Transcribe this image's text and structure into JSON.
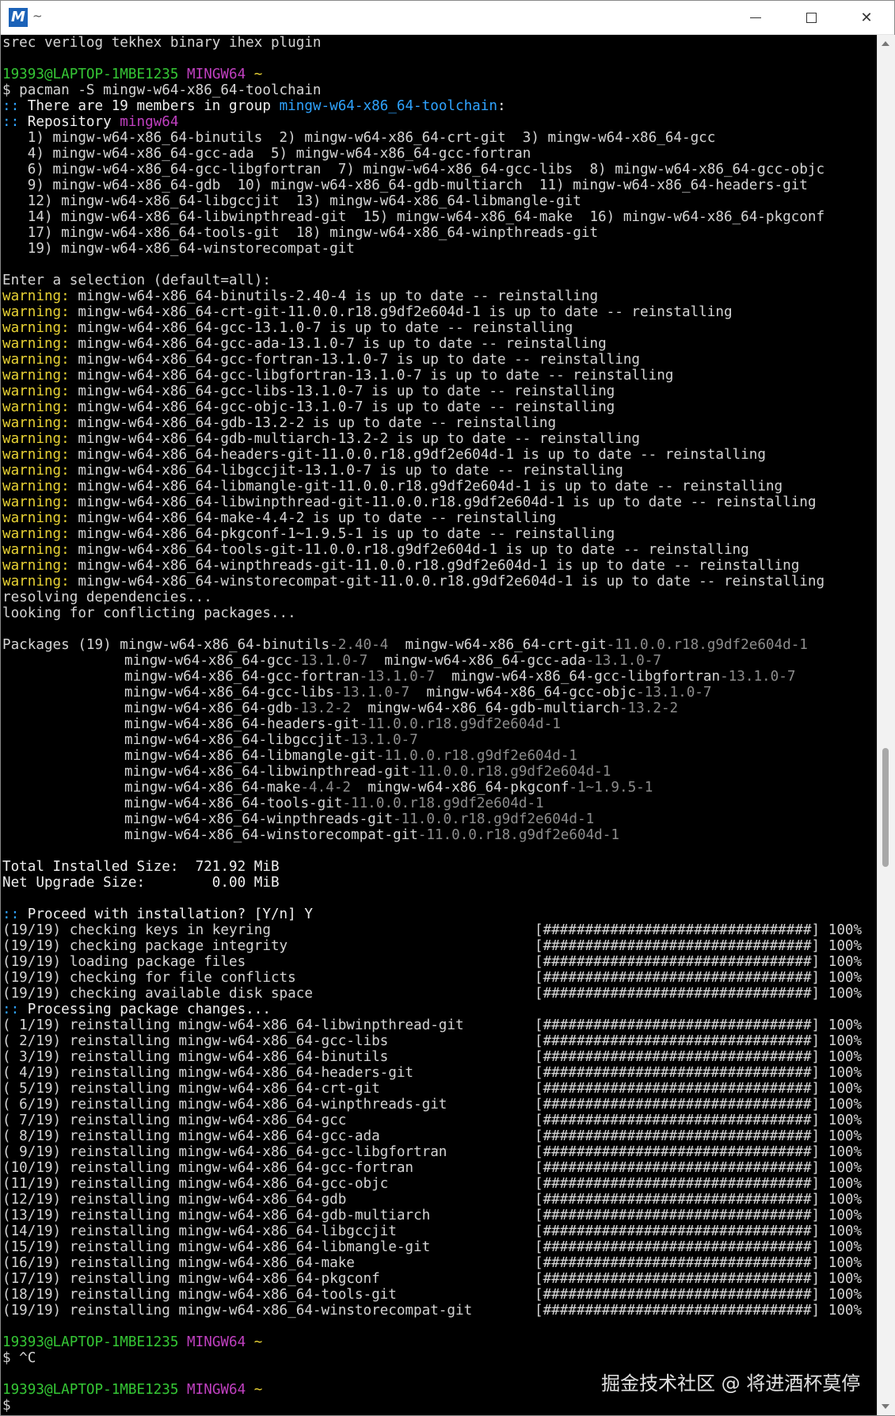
{
  "window": {
    "title": "~",
    "app_icon": "M",
    "controls": {
      "minimize": "minimize-icon",
      "maximize": "maximize-icon",
      "close": "close-icon"
    }
  },
  "prompt": {
    "user_host": "19393@LAPTOP-1MBE1235",
    "env": "MINGW64",
    "dir": "~"
  },
  "lines": {
    "l0": "srec verilog tekhex binary ihex plugin",
    "cmd1": "$ pacman -S mingw-w64-x86_64-toolchain",
    "members_pre": " There are 19 members in group ",
    "group_name": "mingw-w64-x86_64-toolchain",
    "colon": ":",
    "sep": "::",
    "repo_pre": " Repository ",
    "repo_name": "mingw64",
    "g1": "   1) mingw-w64-x86_64-binutils  2) mingw-w64-x86_64-crt-git  3) mingw-w64-x86_64-gcc",
    "g2": "   4) mingw-w64-x86_64-gcc-ada  5) mingw-w64-x86_64-gcc-fortran",
    "g3": "   6) mingw-w64-x86_64-gcc-libgfortran  7) mingw-w64-x86_64-gcc-libs  8) mingw-w64-x86_64-gcc-objc",
    "g4": "   9) mingw-w64-x86_64-gdb  10) mingw-w64-x86_64-gdb-multiarch  11) mingw-w64-x86_64-headers-git",
    "g5": "   12) mingw-w64-x86_64-libgccjit  13) mingw-w64-x86_64-libmangle-git",
    "g6": "   14) mingw-w64-x86_64-libwinpthread-git  15) mingw-w64-x86_64-make  16) mingw-w64-x86_64-pkgconf",
    "g7": "   17) mingw-w64-x86_64-tools-git  18) mingw-w64-x86_64-winpthreads-git",
    "g8": "   19) mingw-w64-x86_64-winstorecompat-git",
    "enter_sel": "Enter a selection (default=all):",
    "warn_label": "warning:",
    "w1": " mingw-w64-x86_64-binutils-2.40-4 is up to date -- reinstalling",
    "w2": " mingw-w64-x86_64-crt-git-11.0.0.r18.g9df2e604d-1 is up to date -- reinstalling",
    "w3": " mingw-w64-x86_64-gcc-13.1.0-7 is up to date -- reinstalling",
    "w4": " mingw-w64-x86_64-gcc-ada-13.1.0-7 is up to date -- reinstalling",
    "w5": " mingw-w64-x86_64-gcc-fortran-13.1.0-7 is up to date -- reinstalling",
    "w6": " mingw-w64-x86_64-gcc-libgfortran-13.1.0-7 is up to date -- reinstalling",
    "w7": " mingw-w64-x86_64-gcc-libs-13.1.0-7 is up to date -- reinstalling",
    "w8": " mingw-w64-x86_64-gcc-objc-13.1.0-7 is up to date -- reinstalling",
    "w9": " mingw-w64-x86_64-gdb-13.2-2 is up to date -- reinstalling",
    "w10": " mingw-w64-x86_64-gdb-multiarch-13.2-2 is up to date -- reinstalling",
    "w11": " mingw-w64-x86_64-headers-git-11.0.0.r18.g9df2e604d-1 is up to date -- reinstalling",
    "w12": " mingw-w64-x86_64-libgccjit-13.1.0-7 is up to date -- reinstalling",
    "w13": " mingw-w64-x86_64-libmangle-git-11.0.0.r18.g9df2e604d-1 is up to date -- reinstalling",
    "w14": " mingw-w64-x86_64-libwinpthread-git-11.0.0.r18.g9df2e604d-1 is up to date -- reinstalling",
    "w15": " mingw-w64-x86_64-make-4.4-2 is up to date -- reinstalling",
    "w16": " mingw-w64-x86_64-pkgconf-1~1.9.5-1 is up to date -- reinstalling",
    "w17": " mingw-w64-x86_64-tools-git-11.0.0.r18.g9df2e604d-1 is up to date -- reinstalling",
    "w18": " mingw-w64-x86_64-winpthreads-git-11.0.0.r18.g9df2e604d-1 is up to date -- reinstalling",
    "w19": " mingw-w64-x86_64-winstorecompat-git-11.0.0.r18.g9df2e604d-1 is up to date -- reinstalling",
    "resolving": "resolving dependencies...",
    "conflicting": "looking for conflicting packages...",
    "pkg_header": "Packages (19) ",
    "pk1a": "mingw-w64-x86_64-binutils",
    "pk1av": "-2.40-4",
    "pk1b": "  mingw-w64-x86_64-crt-git",
    "pk1bv": "-11.0.0.r18.g9df2e604d-1",
    "pk2a": "mingw-w64-x86_64-gcc",
    "pk2av": "-13.1.0-7",
    "pk2b": "  mingw-w64-x86_64-gcc-ada",
    "pk2bv": "-13.1.0-7",
    "pk3a": "mingw-w64-x86_64-gcc-fortran",
    "pk3av": "-13.1.0-7",
    "pk3b": "  mingw-w64-x86_64-gcc-libgfortran",
    "pk3bv": "-13.1.0-7",
    "pk4a": "mingw-w64-x86_64-gcc-libs",
    "pk4av": "-13.1.0-7",
    "pk4b": "  mingw-w64-x86_64-gcc-objc",
    "pk4bv": "-13.1.0-7",
    "pk5a": "mingw-w64-x86_64-gdb",
    "pk5av": "-13.2-2",
    "pk5b": "  mingw-w64-x86_64-gdb-multiarch",
    "pk5bv": "-13.2-2",
    "pk6a": "mingw-w64-x86_64-headers-git",
    "pk6av": "-11.0.0.r18.g9df2e604d-1",
    "pk7a": "mingw-w64-x86_64-libgccjit",
    "pk7av": "-13.1.0-7",
    "pk8a": "mingw-w64-x86_64-libmangle-git",
    "pk8av": "-11.0.0.r18.g9df2e604d-1",
    "pk9a": "mingw-w64-x86_64-libwinpthread-git",
    "pk9av": "-11.0.0.r18.g9df2e604d-1",
    "pk10a": "mingw-w64-x86_64-make",
    "pk10av": "-4.4-2",
    "pk10b": "  mingw-w64-x86_64-pkgconf",
    "pk10bv": "-1~1.9.5-1",
    "pk11a": "mingw-w64-x86_64-tools-git",
    "pk11av": "-11.0.0.r18.g9df2e604d-1",
    "pk12a": "mingw-w64-x86_64-winpthreads-git",
    "pk12av": "-11.0.0.r18.g9df2e604d-1",
    "pk13a": "mingw-w64-x86_64-winstorecompat-git",
    "pk13av": "-11.0.0.r18.g9df2e604d-1",
    "total_installed": "Total Installed Size:  721.92 MiB",
    "net_upgrade": "Net Upgrade Size:        0.00 MiB",
    "proceed": " Proceed with installation? [Y/n] Y",
    "processing": " Processing package changes...",
    "ctrl_c": "$ ^C",
    "dollar": "$"
  },
  "progress_bar": "[################################] 100%",
  "steps": [
    "(19/19) checking keys in keyring",
    "(19/19) checking package integrity",
    "(19/19) loading package files",
    "(19/19) checking for file conflicts",
    "(19/19) checking available disk space"
  ],
  "reinstalls": [
    "( 1/19) reinstalling mingw-w64-x86_64-libwinpthread-git",
    "( 2/19) reinstalling mingw-w64-x86_64-gcc-libs",
    "( 3/19) reinstalling mingw-w64-x86_64-binutils",
    "( 4/19) reinstalling mingw-w64-x86_64-headers-git",
    "( 5/19) reinstalling mingw-w64-x86_64-crt-git",
    "( 6/19) reinstalling mingw-w64-x86_64-winpthreads-git",
    "( 7/19) reinstalling mingw-w64-x86_64-gcc",
    "( 8/19) reinstalling mingw-w64-x86_64-gcc-ada",
    "( 9/19) reinstalling mingw-w64-x86_64-gcc-libgfortran",
    "(10/19) reinstalling mingw-w64-x86_64-gcc-fortran",
    "(11/19) reinstalling mingw-w64-x86_64-gcc-objc",
    "(12/19) reinstalling mingw-w64-x86_64-gdb",
    "(13/19) reinstalling mingw-w64-x86_64-gdb-multiarch",
    "(14/19) reinstalling mingw-w64-x86_64-libgccjit",
    "(15/19) reinstalling mingw-w64-x86_64-libmangle-git",
    "(16/19) reinstalling mingw-w64-x86_64-make",
    "(17/19) reinstalling mingw-w64-x86_64-pkgconf",
    "(18/19) reinstalling mingw-w64-x86_64-tools-git",
    "(19/19) reinstalling mingw-w64-x86_64-winstorecompat-git"
  ],
  "watermark": "掘金技术社区 @ 将进酒杯莫停",
  "colors": {
    "prompt_user": "#35c735",
    "prompt_env": "#c040c0",
    "warning": "#e8d234",
    "highlight": "#2fa3ff",
    "version": "#8c8c8c"
  }
}
